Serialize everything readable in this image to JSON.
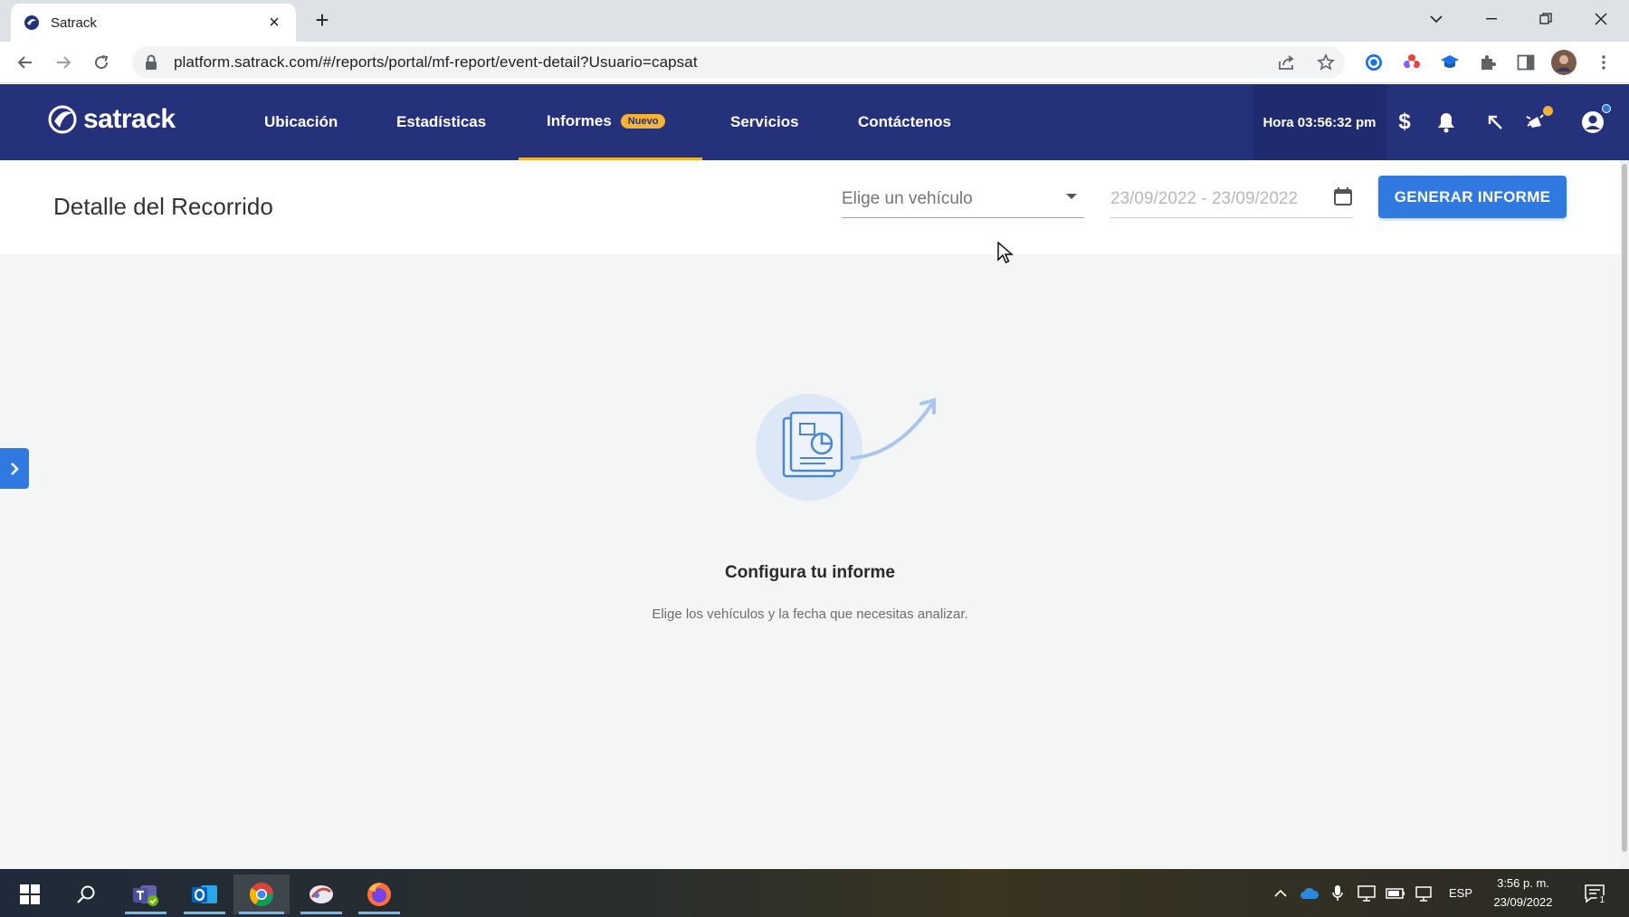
{
  "browser": {
    "tab_title": "Satrack",
    "url": "platform.satrack.com/#/reports/portal/mf-report/event-detail?Usuario=capsat"
  },
  "nav": {
    "brand": "satrack",
    "items": [
      {
        "label": "Ubicación"
      },
      {
        "label": "Estadísticas"
      },
      {
        "label": "Informes",
        "badge": "Nuevo"
      },
      {
        "label": "Servicios"
      },
      {
        "label": "Contáctenos"
      }
    ],
    "clock": "Hora 03:56:32 pm",
    "currency_symbol": "$"
  },
  "page": {
    "title": "Detalle del Recorrido",
    "vehicle_placeholder": "Elige un vehículo",
    "date_range": "23/09/2022 - 23/09/2022",
    "generate_button": "GENERAR INFORME"
  },
  "empty_state": {
    "title": "Configura tu informe",
    "subtitle": "Elige los vehículos y la fecha que necesitas analizar."
  },
  "taskbar": {
    "language": "ESP",
    "time": "3:56 p. m.",
    "date": "23/09/2022",
    "notification_count": "1"
  },
  "colors": {
    "nav_bg": "#25317a",
    "accent": "#2f79e0",
    "badge": "#f5b335"
  }
}
